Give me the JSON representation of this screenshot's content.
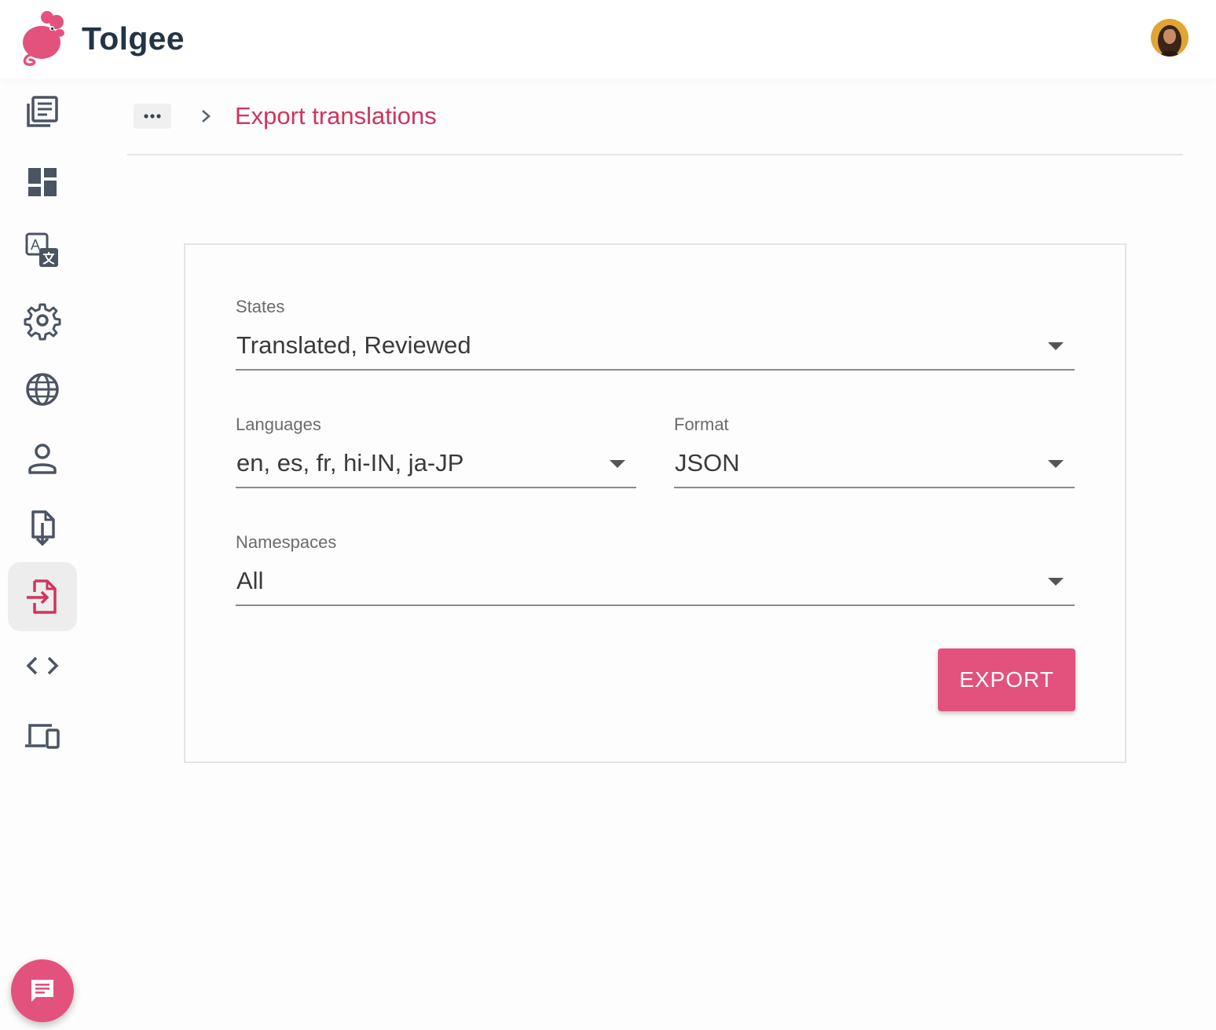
{
  "app": {
    "name": "Tolgee",
    "accent_color": "#e2527d"
  },
  "header": {
    "logo_icon": "tolgee-mouse-logo",
    "avatar_icon": "user-avatar"
  },
  "sidebar": {
    "items": [
      {
        "id": "projects",
        "icon": "projects-list-icon",
        "active": false
      },
      {
        "id": "dashboard",
        "icon": "dashboard-icon",
        "active": false
      },
      {
        "id": "translations",
        "icon": "translate-icon",
        "active": false
      },
      {
        "id": "settings",
        "icon": "gear-icon",
        "active": false
      },
      {
        "id": "languages",
        "icon": "globe-icon",
        "active": false
      },
      {
        "id": "members",
        "icon": "person-icon",
        "active": false
      },
      {
        "id": "import",
        "icon": "file-import-icon",
        "active": false
      },
      {
        "id": "export",
        "icon": "file-export-icon",
        "active": true
      },
      {
        "id": "developer",
        "icon": "code-icon",
        "active": false
      },
      {
        "id": "integrate",
        "icon": "devices-icon",
        "active": false
      }
    ]
  },
  "breadcrumb": {
    "more_icon": "more-horizontal-icon",
    "separator_icon": "chevron-right-icon",
    "current": "Export translations"
  },
  "form": {
    "states": {
      "label": "States",
      "value": "Translated, Reviewed"
    },
    "languages": {
      "label": "Languages",
      "value": "en, es, fr, hi-IN, ja-JP"
    },
    "format": {
      "label": "Format",
      "value": "JSON"
    },
    "namespaces": {
      "label": "Namespaces",
      "value": "All"
    },
    "export_label": "EXPORT"
  },
  "chat": {
    "icon": "chat-bubble-icon"
  }
}
